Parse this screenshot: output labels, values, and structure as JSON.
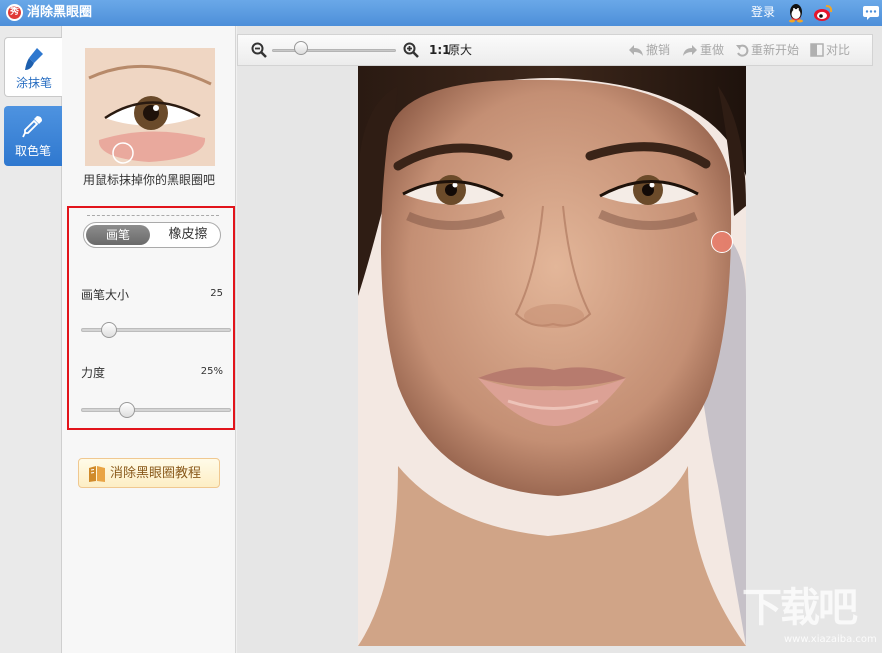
{
  "app": {
    "title": "消除黑眼圈",
    "logo_char": "秀",
    "login_label": "登录"
  },
  "tools": [
    {
      "label": "涂抹笔",
      "icon": "brush-icon",
      "active": true
    },
    {
      "label": "取色笔",
      "icon": "eyedropper-icon",
      "active": false
    }
  ],
  "panel": {
    "hint": "用鼠标抹掉你的黑眼圈吧",
    "mode": {
      "brush_label": "画笔",
      "eraser_label": "橡皮擦",
      "selected": "画笔"
    },
    "brush_size": {
      "label": "画笔大小",
      "value": "25",
      "level": 0.15
    },
    "strength": {
      "label": "力度",
      "value": "25%",
      "level": 0.28
    },
    "tutorial_label": "消除黑眼圈教程"
  },
  "toolbar": {
    "zoom_level": 0.2,
    "ratio_label": "1:1",
    "original_label": "原大",
    "undo_label": "撤销",
    "redo_label": "重做",
    "restart_label": "重新开始",
    "compare_label": "对比"
  },
  "watermark": {
    "text": "下载吧",
    "sub": "www.xiazaiba.com"
  },
  "colors": {
    "titlebar": "#5a9be0",
    "accent_blue": "#2f78cf",
    "highlight_red": "#e2141b",
    "brush_cursor": "#ec806e"
  }
}
